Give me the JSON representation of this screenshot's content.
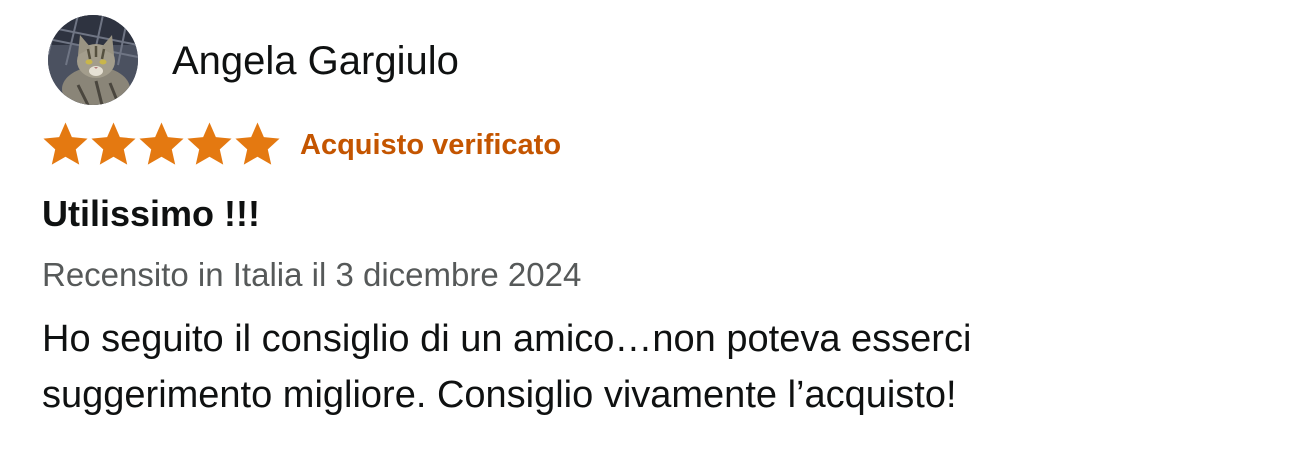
{
  "review": {
    "reviewer_name": "Angela Gargiulo",
    "avatar_icon": "cat-photo-avatar",
    "rating": 5,
    "rating_max": 5,
    "star_color": "#e47911",
    "verified_label": "Acquisto verificato",
    "verified_color": "#c45500",
    "title": "Utilissimo !!!",
    "date": "Recensito in Italia il 3 dicembre 2024",
    "body_lines": [
      "Ho seguito il consiglio di un amico…non poteva esserci",
      "suggerimento migliore. Consiglio vivamente l’acquisto!"
    ]
  }
}
